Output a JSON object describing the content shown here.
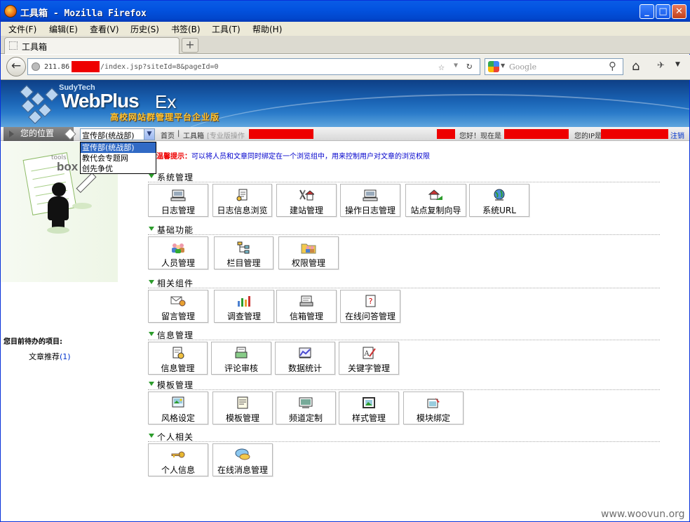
{
  "window": {
    "title": "工具箱 - Mozilla Firefox",
    "min_glyph": "_",
    "max_glyph": "□",
    "close_glyph": "✕"
  },
  "menubar": [
    "文件(F)",
    "编辑(E)",
    "查看(V)",
    "历史(S)",
    "书签(B)",
    "工具(T)",
    "帮助(H)"
  ],
  "tab": {
    "label": "工具箱",
    "new_tab_glyph": "+"
  },
  "nav": {
    "url_prefix": "211.86",
    "url_suffix": "/index.jsp?siteId=8&pageId=0",
    "search_placeholder": "Google"
  },
  "banner": {
    "brand_small": "SudyTech",
    "brand_main": "WebPlus",
    "brand_ex": "Ex",
    "subtitle": "高校网站群管理平台企业版"
  },
  "location": {
    "label": "您的位置",
    "selected_site": "宣传部(统战部)",
    "crumbs": [
      "首页",
      "|",
      "工具箱",
      "[专业版操作"
    ],
    "greeting": "您好！现在是",
    "ip_label": "您的IP是",
    "logout": "注销"
  },
  "site_options": [
    "宣传部(统战部)",
    "教代会专题网",
    "创先争优"
  ],
  "left_panel": {
    "illustration_text_small": "tools",
    "illustration_text_big": "box",
    "pending_title": "您目前待办的项目:",
    "pending_items": [
      {
        "label": "文章推荐",
        "count": "(1)"
      }
    ]
  },
  "tip": {
    "label": "温馨提示：",
    "text": "可以将人员和文章同时绑定在一个浏览组中，用来控制用户对文章的浏览权限"
  },
  "sections": [
    {
      "title": "系统管理",
      "tiles": [
        {
          "label": "日志管理",
          "icon": "computer-icon"
        },
        {
          "label": "日志信息浏览",
          "icon": "document-icon"
        },
        {
          "label": "建站管理",
          "icon": "tools-house-icon"
        },
        {
          "label": "操作日志管理",
          "icon": "computer-icon"
        },
        {
          "label": "站点复制向导",
          "icon": "house-copy-icon"
        },
        {
          "label": "系统URL",
          "icon": "globe-icon"
        }
      ]
    },
    {
      "title": "基础功能",
      "tiles": [
        {
          "label": "人员管理",
          "icon": "people-icon"
        },
        {
          "label": "栏目管理",
          "icon": "tree-icon"
        },
        {
          "label": "权限管理",
          "icon": "folder-people-icon"
        }
      ]
    },
    {
      "title": "相关组件",
      "tiles": [
        {
          "label": "留言管理",
          "icon": "message-icon"
        },
        {
          "label": "调查管理",
          "icon": "bar-chart-icon"
        },
        {
          "label": "信箱管理",
          "icon": "mailbox-icon"
        },
        {
          "label": "在线问答管理",
          "icon": "question-icon"
        }
      ]
    },
    {
      "title": "信息管理",
      "tiles": [
        {
          "label": "信息管理",
          "icon": "info-doc-icon"
        },
        {
          "label": "评论审核",
          "icon": "comment-icon"
        },
        {
          "label": "数据统计",
          "icon": "chart-picture-icon"
        },
        {
          "label": "关键字管理",
          "icon": "keyword-icon"
        }
      ]
    },
    {
      "title": "模板管理",
      "tiles": [
        {
          "label": "风格设定",
          "icon": "style-icon"
        },
        {
          "label": "模板管理",
          "icon": "template-icon"
        },
        {
          "label": "频道定制",
          "icon": "channel-icon"
        },
        {
          "label": "样式管理",
          "icon": "frame-icon"
        },
        {
          "label": "模块绑定",
          "icon": "module-icon"
        }
      ]
    },
    {
      "title": "个人相关",
      "tiles": [
        {
          "label": "个人信息",
          "icon": "key-icon"
        },
        {
          "label": "在线消息管理",
          "icon": "chat-icon"
        }
      ]
    }
  ],
  "watermark": "www.woovun.org",
  "colors": {
    "accent": "#2c9c2c",
    "tip_label": "#e00000",
    "tip_text": "#0000cc",
    "redaction": "#e00000"
  }
}
